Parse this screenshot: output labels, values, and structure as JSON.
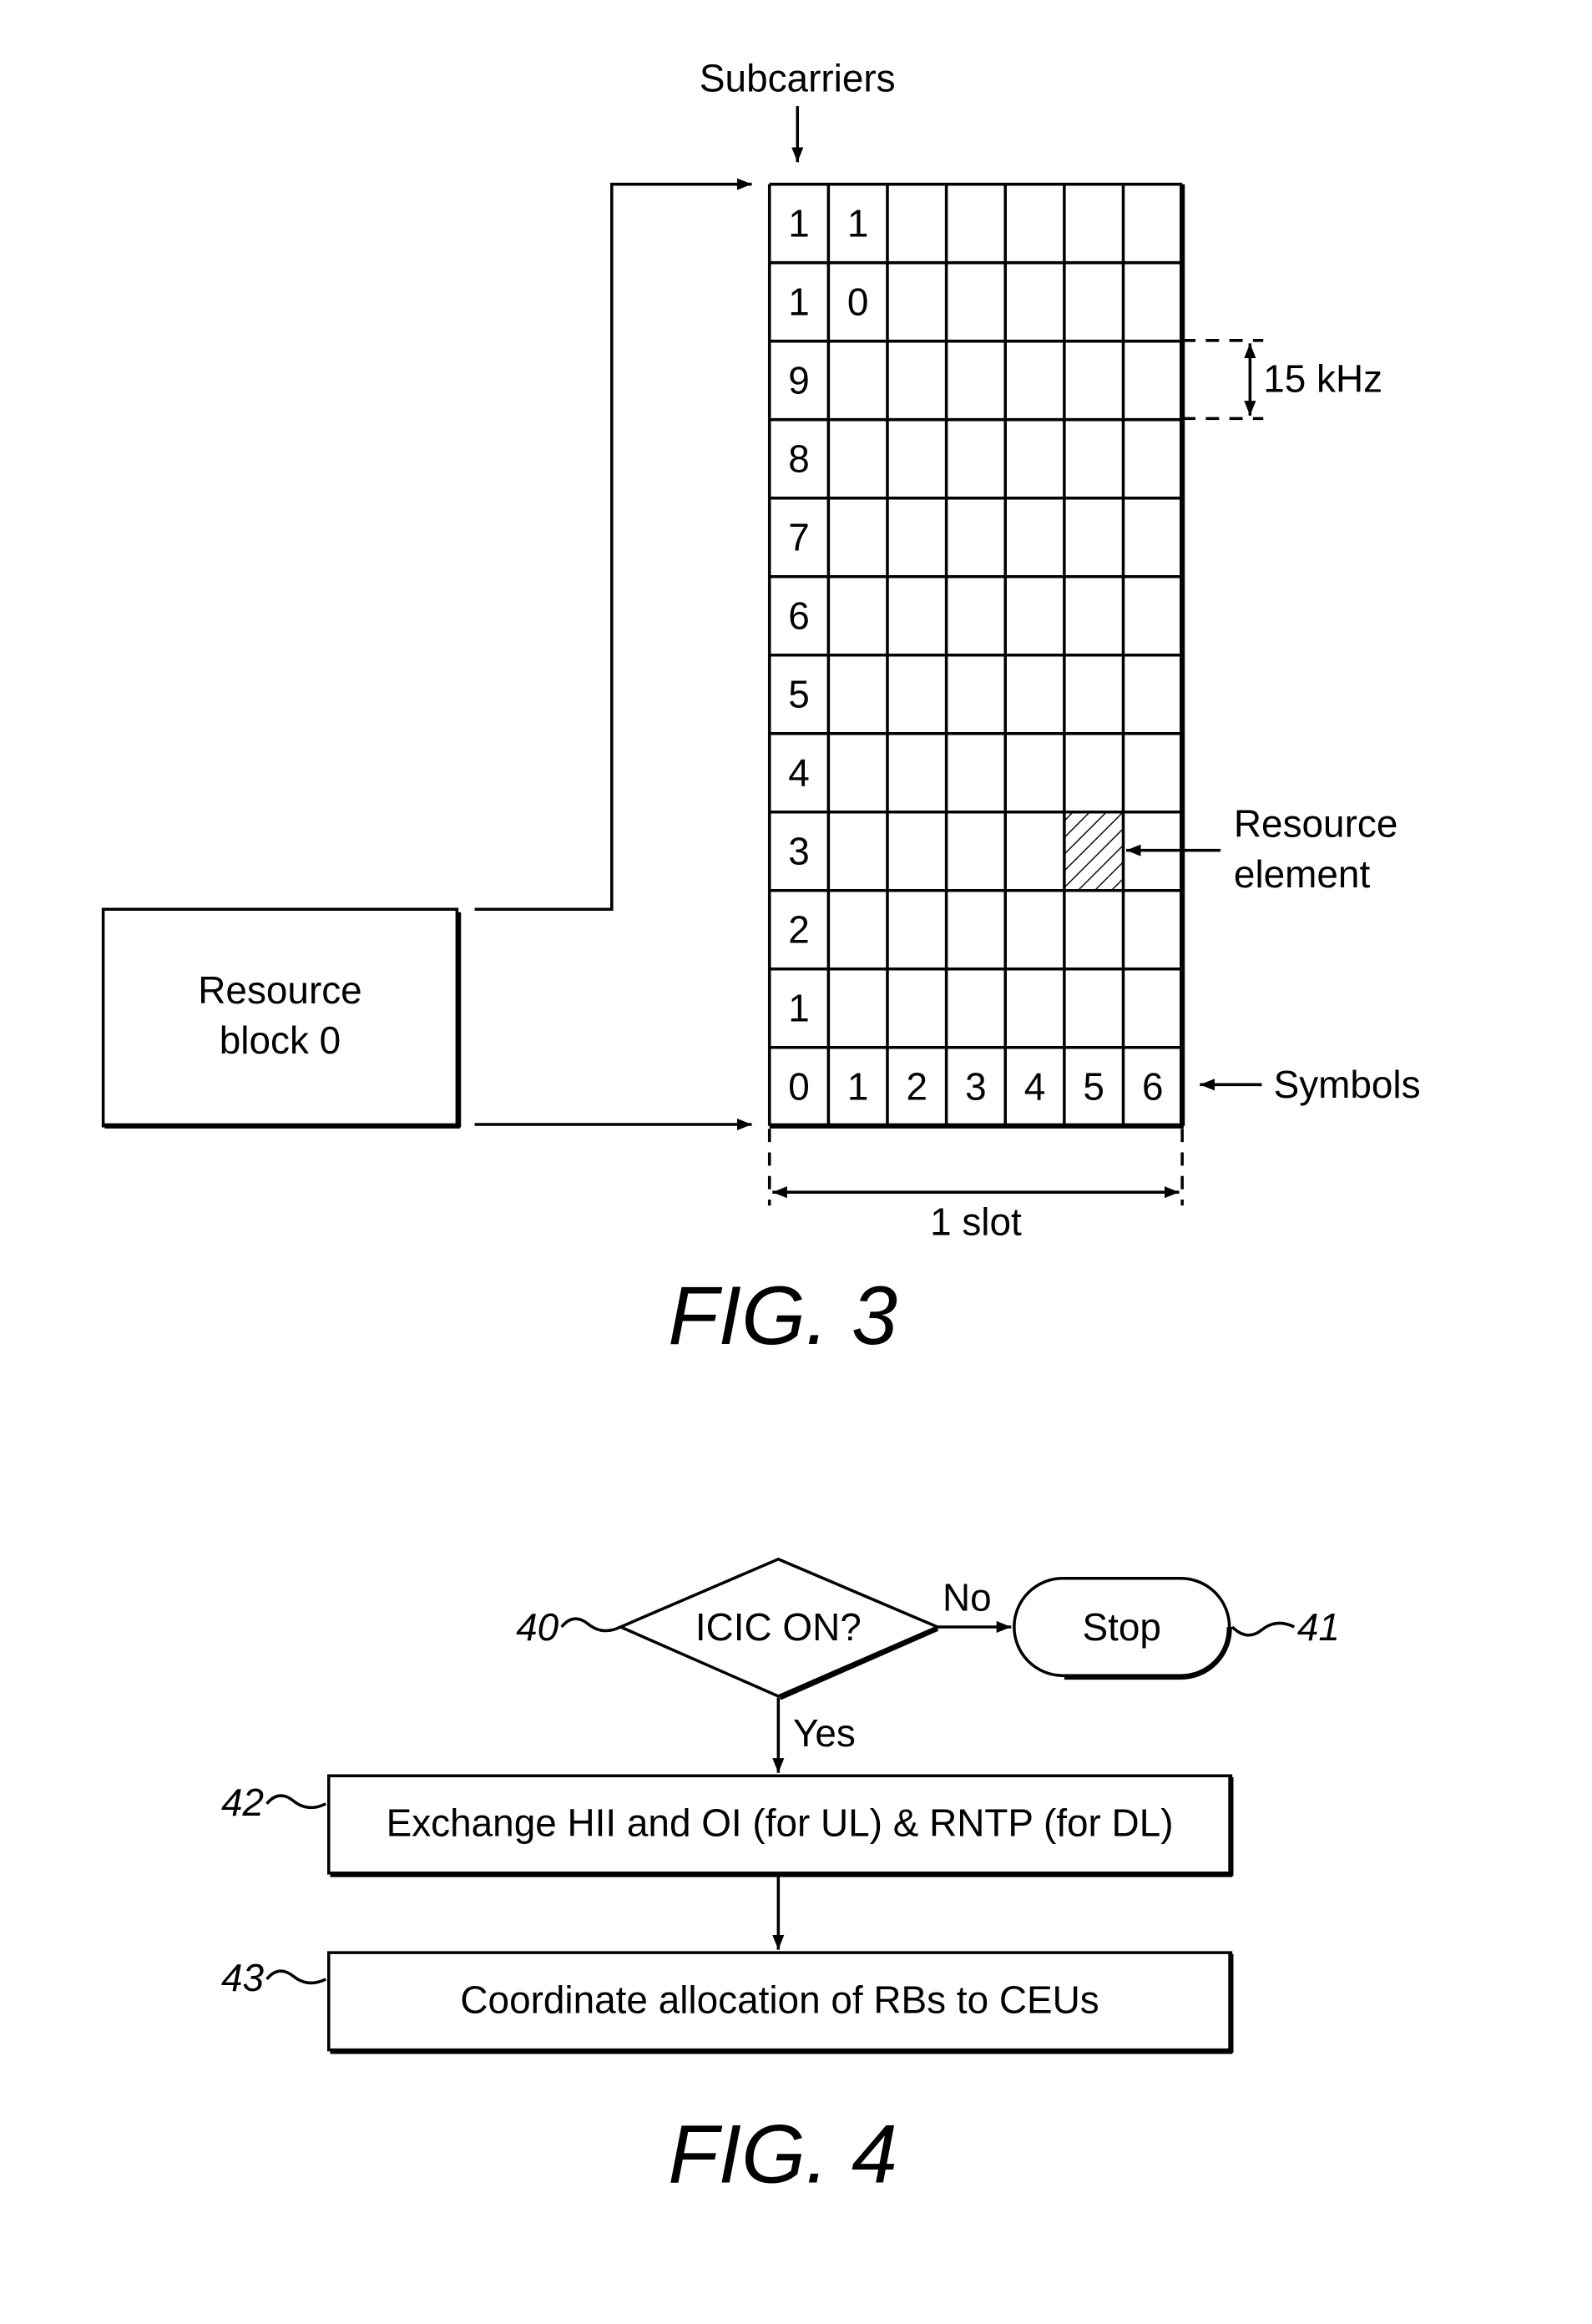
{
  "fig3": {
    "caption": "FIG. 3",
    "subcarriers_label": "Subcarriers",
    "resource_block_label_line1": "Resource",
    "resource_block_label_line2": "block 0",
    "subcarrier_spacing_label": "15 kHz",
    "resource_element_label_line1": "Resource",
    "resource_element_label_line2": "element",
    "symbols_label": "Symbols",
    "slot_label": "1 slot",
    "num_symbols": 7,
    "num_subcarriers": 12,
    "subcarrier_row_labels": [
      [
        "1",
        "1"
      ],
      [
        "1",
        "0"
      ],
      [
        "9"
      ],
      [
        "8"
      ],
      [
        "7"
      ],
      [
        "6"
      ],
      [
        "5"
      ],
      [
        "4"
      ],
      [
        "3"
      ],
      [
        "2"
      ],
      [
        "1"
      ],
      [
        "0",
        "1",
        "2",
        "3",
        "4",
        "5",
        "6"
      ]
    ],
    "highlighted_resource_element": {
      "symbol": 5,
      "subcarrier": 3
    }
  },
  "fig4": {
    "caption": "FIG. 4",
    "decision": {
      "ref": "40",
      "text": "ICIC ON?"
    },
    "no_label": "No",
    "yes_label": "Yes",
    "stop": {
      "ref": "41",
      "text": "Stop"
    },
    "step42": {
      "ref": "42",
      "text": "Exchange HII and OI (for UL) & RNTP (for DL)"
    },
    "step43": {
      "ref": "43",
      "text": "Coordinate allocation of RBs to CEUs"
    }
  }
}
